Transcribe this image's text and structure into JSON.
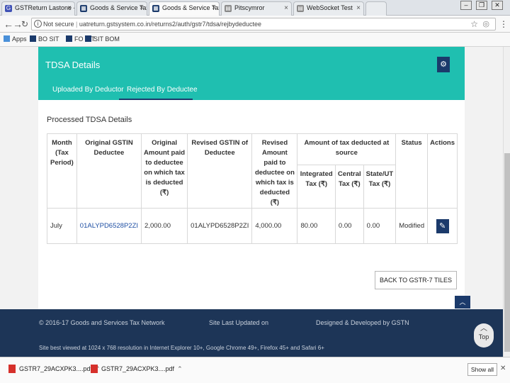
{
  "browser": {
    "tabs": [
      {
        "title": "GSTReturn Lastone - Ag",
        "color": "#3f51b5",
        "active": false
      },
      {
        "title": "Goods & Service Tax (GS",
        "color": "#1b3a6b",
        "active": false
      },
      {
        "title": "Goods & Service Tax (GS",
        "color": "#1b3a6b",
        "active": true
      },
      {
        "title": "Pitscymror",
        "color": "#888888",
        "active": false
      },
      {
        "title": "WebSocket Test",
        "color": "#888888",
        "active": false
      }
    ],
    "tab_close": "×",
    "address": {
      "security_text": "Not secure",
      "url": "uatreturn.gstsystem.co.in/returns2/auth/gstr7/tdsa/rejbydeductee"
    },
    "bookmarks": [
      {
        "label": "Apps",
        "color": "#4a90d9"
      },
      {
        "label": "BO SIT",
        "color": "#1b3a6b"
      },
      {
        "label": "FO SIT",
        "color": "#1b3a6b"
      },
      {
        "label": "SIT BOM",
        "color": "#1b3a6b"
      }
    ]
  },
  "panel": {
    "title": "TDSA Details",
    "tabs": [
      "Uploaded By Deductor",
      "Rejected By Deductee"
    ],
    "active_tab": 1
  },
  "section": {
    "title": "Processed TDSA Details"
  },
  "table": {
    "headers": {
      "month": "Month (Tax Period)",
      "orig_gstin": "Original GSTIN Deductee",
      "orig_amount": "Original Amount paid to deductee on which tax is deducted (₹)",
      "rev_gstin": "Revised GSTIN of Deductee",
      "rev_amount": "Revised Amount paid to deductee on which tax is deducted (₹)",
      "tax_group": "Amount of tax deducted at source",
      "igst": "Integrated Tax (₹)",
      "cgst": "Central Tax (₹)",
      "sgst": "State/UT Tax (₹)",
      "status": "Status",
      "actions": "Actions"
    },
    "rows": [
      {
        "month": "July",
        "orig_gstin": "01ALYPD6528P2ZI",
        "orig_amount": "2,000.00",
        "rev_gstin": "01ALYPD6528P2ZI",
        "rev_amount": "4,000.00",
        "igst": "80.00",
        "cgst": "0.00",
        "sgst": "0.00",
        "status": "Modified"
      }
    ]
  },
  "buttons": {
    "back": "BACK TO GSTR-7 TILES",
    "top_label": "Top"
  },
  "footer": {
    "copyright": "© 2016-17 Goods and Services Tax Network",
    "last_updated": "Site Last Updated on",
    "designed": "Designed & Developed by GSTN",
    "best_viewed": "Site best viewed at 1024 x 768 resolution in Internet Explorer 10+, Google Chrome 49+, Firefox 45+ and Safari 6+"
  },
  "downloads": {
    "files": [
      "GSTR7_29ACXPK3....pdf",
      "GSTR7_29ACXPK3....pdf"
    ],
    "show_all": "Show all"
  },
  "colors": {
    "teal": "#1fbfb0",
    "navy": "#1b3a6b",
    "footer": "#1d3557"
  }
}
